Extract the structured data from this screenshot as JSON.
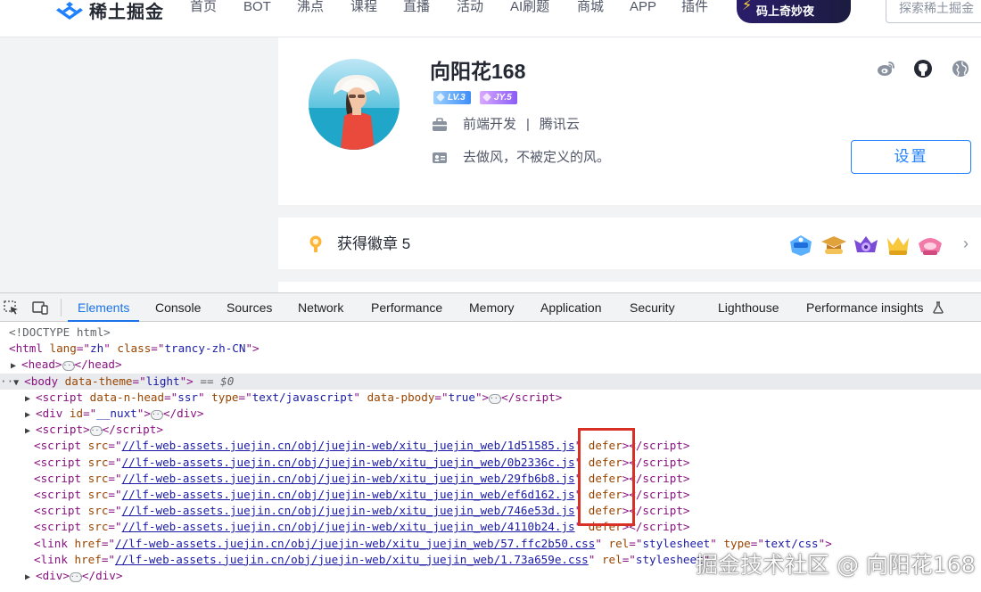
{
  "nav": {
    "logo_text": "稀土掘金",
    "items": [
      "首页",
      "BOT",
      "沸点",
      "课程",
      "直播",
      "活动",
      "AI刷题",
      "商城",
      "APP",
      "插件"
    ],
    "promo_text": "码上奇妙夜",
    "search_placeholder": "探索稀土掘金"
  },
  "profile": {
    "username": "向阳花168",
    "level_badge": "LV.3",
    "jy_badge": "JY.5",
    "job": "前端开发",
    "company": "腾讯云",
    "bio": "去做风，不被定义的风。",
    "settings_label": "设置",
    "social_icons": [
      "weibo-icon",
      "github-icon",
      "globe-icon"
    ]
  },
  "badges": {
    "title": "获得徽章 5",
    "count": 5
  },
  "devtools": {
    "tabs": [
      "Elements",
      "Console",
      "Sources",
      "Network",
      "Performance",
      "Memory",
      "Application",
      "Security",
      "Lighthouse",
      "Performance insights"
    ],
    "active_tab": "Elements",
    "doctype": "<!DOCTYPE html>",
    "html_tag": {
      "lang": "zh",
      "class": "trancy-zh-CN"
    },
    "body_theme": "light",
    "body_suffix": "== $0",
    "script_head": {
      "n_head": "ssr",
      "type": "text/javascript",
      "pbody": "true"
    },
    "div_id": "__nuxt",
    "script_srcs": [
      "//lf-web-assets.juejin.cn/obj/juejin-web/xitu_juejin_web/1d51585.js",
      "//lf-web-assets.juejin.cn/obj/juejin-web/xitu_juejin_web/0b2336c.js",
      "//lf-web-assets.juejin.cn/obj/juejin-web/xitu_juejin_web/29fb6b8.js",
      "//lf-web-assets.juejin.cn/obj/juejin-web/xitu_juejin_web/ef6d162.js",
      "//lf-web-assets.juejin.cn/obj/juejin-web/xitu_juejin_web/746e53d.js",
      "//lf-web-assets.juejin.cn/obj/juejin-web/xitu_juejin_web/4110b24.js"
    ],
    "defer_attr": "defer",
    "css_links": [
      "//lf-web-assets.juejin.cn/obj/juejin-web/xitu_juejin_web/57.ffc2b50.css",
      "//lf-web-assets.juejin.cn/obj/juejin-web/xitu_juejin_web/1.73a659e.css"
    ],
    "rel_value": "stylesheet",
    "type_css": "text/css"
  },
  "watermark": "掘金技术社区 @ 向阳花168",
  "colors": {
    "brand_blue": "#1e80ff",
    "highlight_red": "#d93025",
    "page_bg": "#f2f3f5"
  }
}
